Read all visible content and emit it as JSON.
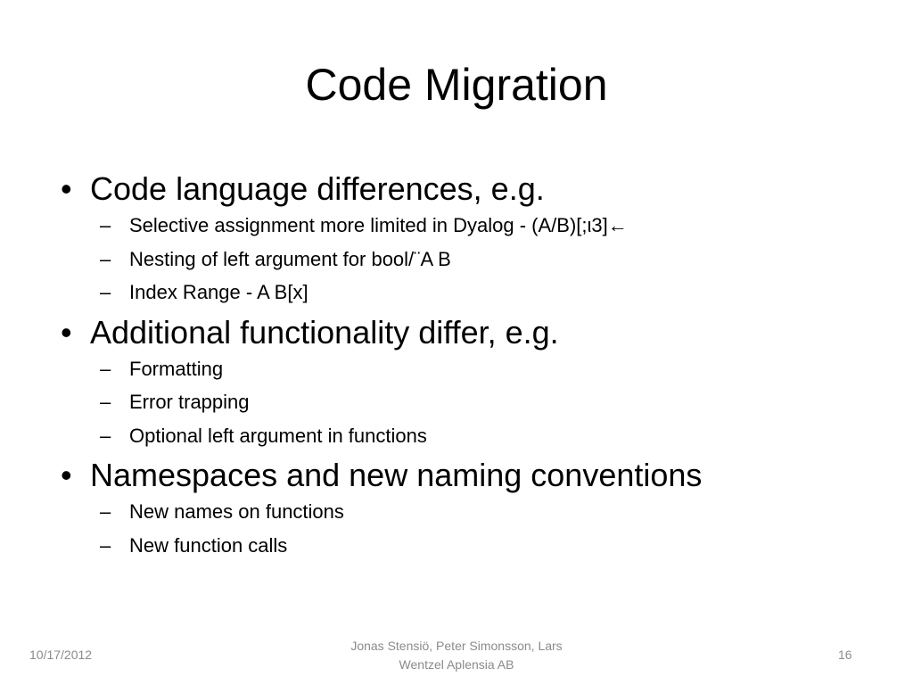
{
  "slide": {
    "title": "Code Migration",
    "bullets": [
      {
        "text": "Code language differences, e.g.",
        "sub": [
          "Selective assignment more limited in Dyalog -  (A/B)[;ι3]←",
          "Nesting of left argument for bool/¨A B",
          "Index Range - A B[x]"
        ]
      },
      {
        "text": "Additional functionality differ, e.g.",
        "sub": [
          "Formatting",
          "Error trapping",
          "Optional left argument in functions"
        ]
      },
      {
        "text": "Namespaces and new naming conventions",
        "sub": [
          "New names on functions",
          "New function calls"
        ]
      }
    ],
    "bullet_glyph": "•",
    "dash_glyph": "–"
  },
  "footer": {
    "date": "10/17/2012",
    "authors_line1": "Jonas Stensiö, Peter Simonsson, Lars",
    "authors_line2": "Wentzel  Aplensia AB",
    "page": "16"
  }
}
